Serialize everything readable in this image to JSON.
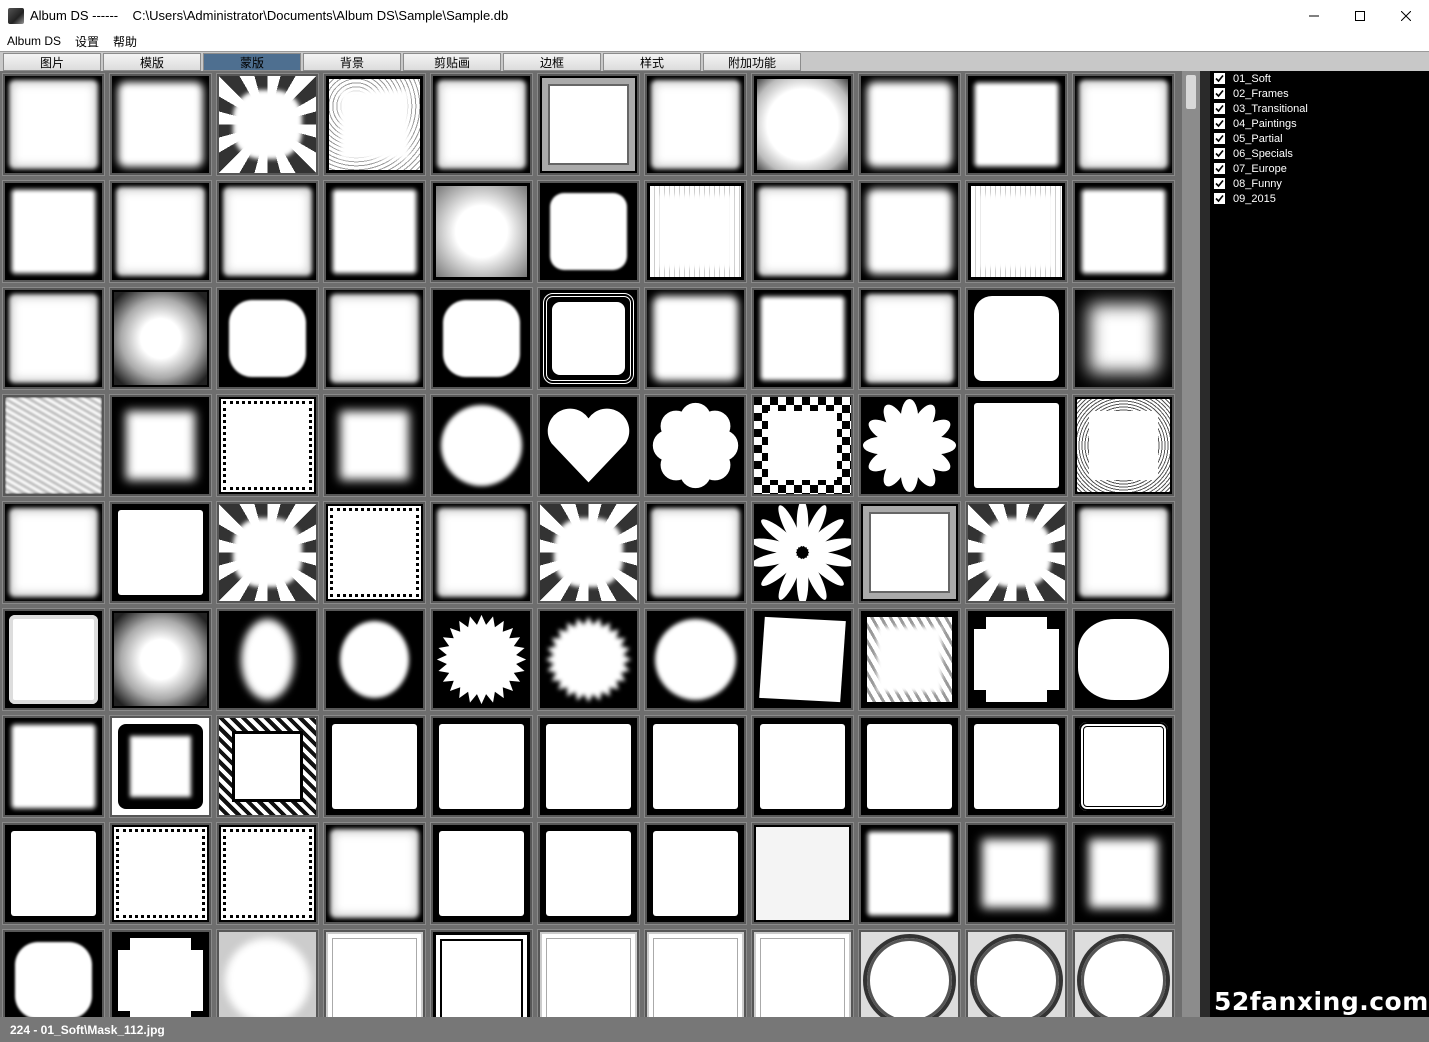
{
  "window": {
    "title": "Album DS ------    C:\\Users\\Administrator\\Documents\\Album DS\\Sample\\Sample.db",
    "icon": "album-ds-app-icon"
  },
  "menu": {
    "items": [
      "Album DS",
      "设置",
      "帮助"
    ]
  },
  "tabs": [
    {
      "label": "图片",
      "active": false
    },
    {
      "label": "模版",
      "active": false
    },
    {
      "label": "蒙版",
      "active": true
    },
    {
      "label": "背景",
      "active": false
    },
    {
      "label": "剪贴画",
      "active": false
    },
    {
      "label": "边框",
      "active": false
    },
    {
      "label": "样式",
      "active": false
    },
    {
      "label": "附加功能",
      "active": false
    }
  ],
  "categories": [
    {
      "label": "01_Soft",
      "checked": true
    },
    {
      "label": "02_Frames",
      "checked": true
    },
    {
      "label": "03_Transitional",
      "checked": true
    },
    {
      "label": "04_Paintings",
      "checked": true
    },
    {
      "label": "05_Partial",
      "checked": true
    },
    {
      "label": "06_Specials",
      "checked": true
    },
    {
      "label": "07_Europe",
      "checked": true
    },
    {
      "label": "08_Funny",
      "checked": true
    },
    {
      "label": "09_2015",
      "checked": true
    }
  ],
  "thumbnails": [
    [
      "soft-rough",
      "soft-blur",
      "leaf-frame",
      "speckle",
      "soft-rough",
      "inset-frame",
      "soft-rough",
      "soft-speckle",
      "soft-blur",
      "dark-rough",
      "soft-rough"
    ],
    [
      "dark-rough",
      "soft-rough",
      "soft-rough",
      "dark-rough",
      "patchy",
      "dark-blob",
      "soft-grid",
      "soft-rough",
      "soft-blur",
      "soft-grid",
      "dark-rough"
    ],
    [
      "soft-rough",
      "cloud",
      "blob",
      "soft-rough",
      "blob",
      "lace",
      "soft-blur",
      "dark-rough",
      "soft-rough",
      "clouds-top",
      "big-blur"
    ],
    [
      "streak",
      "square-blur",
      "zigzag",
      "square-blur",
      "circle",
      "heart",
      "flower-small",
      "checker",
      "daisy",
      "square-sharp",
      "bubble-frame"
    ],
    [
      "soft-rough",
      "square-sharp",
      "leaf-frame",
      "zigzag",
      "soft-rough",
      "leaf-frame",
      "soft-rough",
      "star-flower",
      "inset-frame",
      "leaf-frame",
      "soft-rough"
    ],
    [
      "paper",
      "cloud",
      "oval-blur",
      "oval",
      "sunburst",
      "sunburst-soft",
      "circle",
      "jagged",
      "jagged-soft",
      "castle",
      "ornate"
    ],
    [
      "dark-rough",
      "black-frame",
      "film-frame",
      "square-sharp",
      "square-sharp",
      "square-sharp",
      "square-sharp",
      "square-sharp",
      "square-sharp",
      "square-sharp",
      "double-rounded"
    ],
    [
      "square-sharp",
      "zigzag",
      "zigzag",
      "soft-rough",
      "square-sharp",
      "square-sharp",
      "square-sharp",
      "square-light",
      "dark-rough",
      "square-blur",
      "square-blur"
    ],
    [
      "blob",
      "castle",
      "circle-soft",
      "lines-frame",
      "line-frame-dark",
      "lines-frame",
      "lines-frame",
      "lines-frame",
      "circle-ring",
      "circle-ring",
      "circle-ring"
    ]
  ],
  "watermark": "52fanxing.com",
  "status": "224 - 01_Soft\\Mask_112.jpg"
}
